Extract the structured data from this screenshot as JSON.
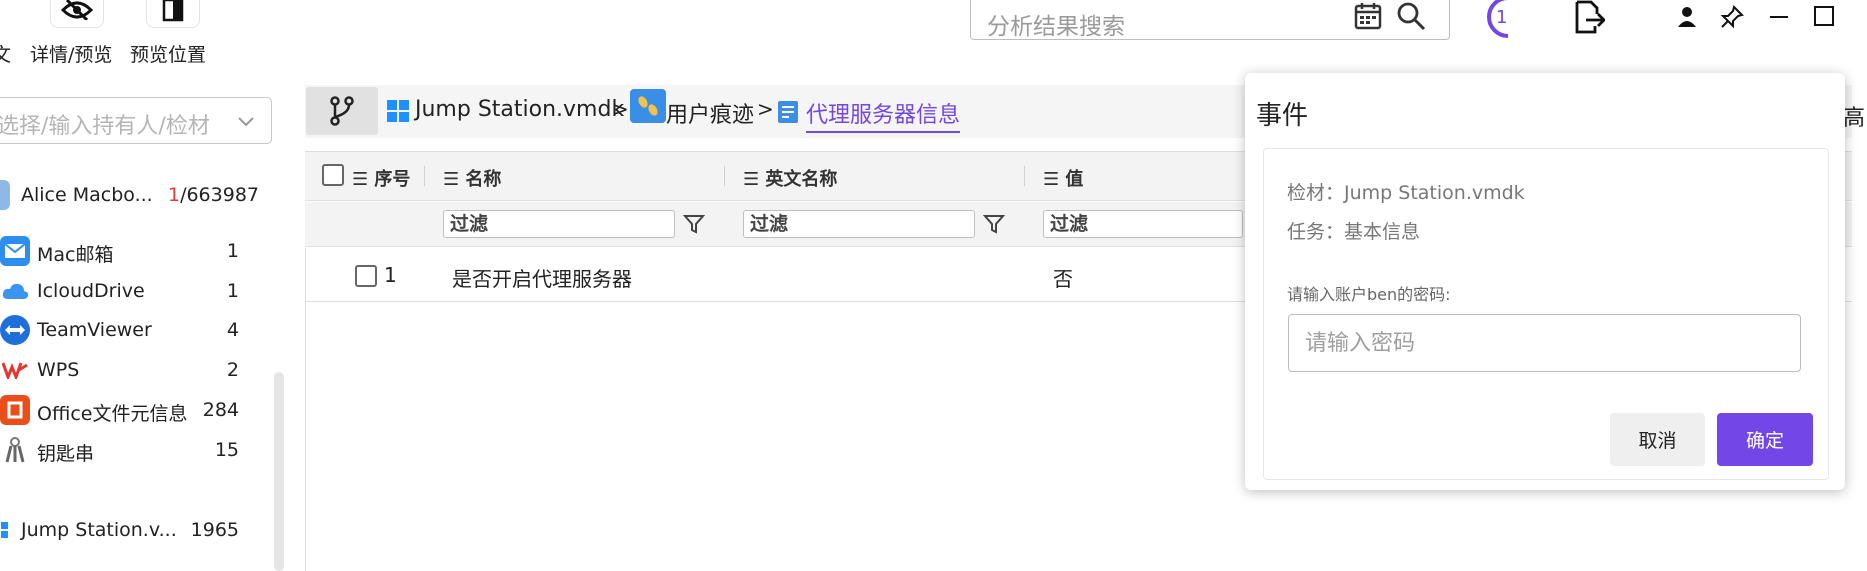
{
  "toolbar": {
    "left_cut_label": "文",
    "details_preview_label": "详情/预览",
    "preview_position_label": "预览位置",
    "search_placeholder": "分析结果搜索",
    "task_count": "1",
    "partial_right_text": "高"
  },
  "left_panel": {
    "owner_select_placeholder": "选择/输入持有人/检材",
    "items": [
      {
        "label": "Alice  Macbo...",
        "count_highlight": "1",
        "count_rest": "/663987",
        "icon": "device-icon"
      },
      {
        "label": "Mac邮箱",
        "count": "1",
        "icon": "mail-icon"
      },
      {
        "label": "IcloudDrive",
        "count": "1",
        "icon": "cloud-icon"
      },
      {
        "label": "TeamViewer",
        "count": "4",
        "icon": "teamviewer-icon"
      },
      {
        "label": "WPS",
        "count": "2",
        "icon": "wps-icon"
      },
      {
        "label": "Office文件元信息",
        "count": "284",
        "icon": "office-icon"
      },
      {
        "label": "钥匙串",
        "count": "15",
        "icon": "keychain-icon"
      },
      {
        "label": "Jump Station.v...",
        "count": "1965",
        "icon": "windows-icon"
      }
    ]
  },
  "breadcrumb": {
    "items": [
      "Jump Station.vmdk",
      "用户痕迹",
      "代理服务器信息"
    ],
    "separator": ">"
  },
  "table": {
    "columns": [
      "序号",
      "名称",
      "英文名称",
      "值"
    ],
    "filter_placeholder": "过滤",
    "rows": [
      {
        "index": "1",
        "name": "是否开启代理服务器",
        "english_name": "",
        "value": "否"
      }
    ]
  },
  "dialog": {
    "title": "事件",
    "evidence_label": "检材：",
    "evidence_value": "Jump Station.vmdk",
    "task_label": "任务：",
    "task_value": "基本信息",
    "prompt": "请输入账户ben的密码:",
    "password_placeholder": "请输入密码",
    "password_value": "",
    "cancel_label": "取消",
    "ok_label": "确定"
  },
  "colors": {
    "accent": "#7346e8",
    "count_highlight": "#e53935",
    "breadcrumb_active": "#7346e8"
  }
}
